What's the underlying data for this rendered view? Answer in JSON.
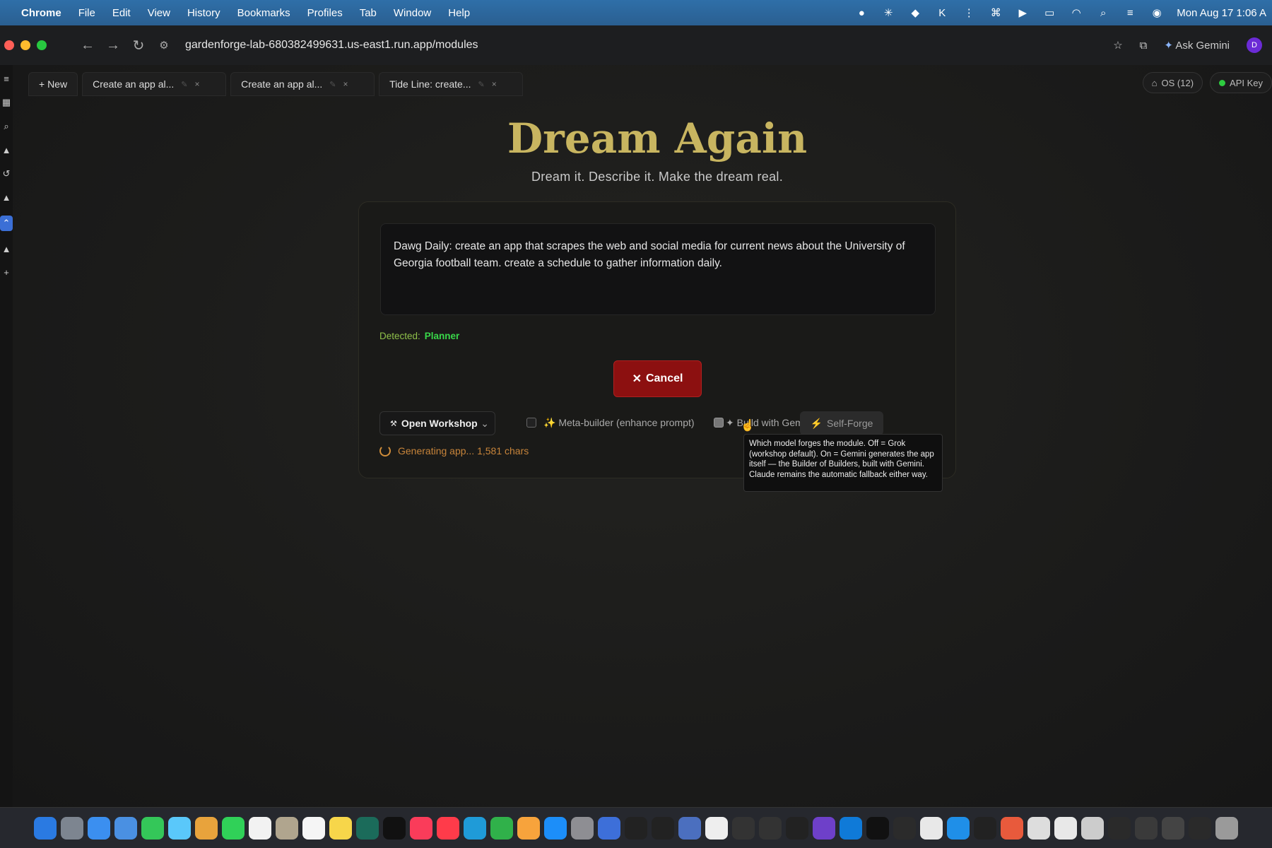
{
  "menubar": {
    "app": "Chrome",
    "items": [
      "File",
      "Edit",
      "View",
      "History",
      "Bookmarks",
      "Profiles",
      "Tab",
      "Window",
      "Help"
    ],
    "clock": "Mon Aug 17  1:06 A"
  },
  "browser": {
    "url": "gardenforge-lab-680382499631.us-east1.run.app/modules",
    "ask_gemini": "Ask Gemini",
    "profile_initial": "D"
  },
  "tabs": {
    "new_label": "+ New",
    "items": [
      {
        "label": "Create an app al..."
      },
      {
        "label": "Create an app al..."
      },
      {
        "label": "Tide Line: create..."
      }
    ]
  },
  "topright": {
    "os_label": "OS (12)",
    "api_label": "API Key"
  },
  "hero": {
    "title": "Dream Again",
    "subtitle": "Dream it. Describe it. Make the dream real."
  },
  "prompt": {
    "text": "Dawg Daily: create an app that scrapes the web and social media for current news about the University of Georgia football team. create a schedule to gather information daily."
  },
  "detected": {
    "label": "Detected:",
    "value": "Planner"
  },
  "cancel_label": "Cancel",
  "controls": {
    "workshop_label": "Open Workshop",
    "meta_builder_label": "Meta-builder (enhance prompt)",
    "build_gemini_label": "Build with Gemini",
    "self_forge_label": "Self-Forge"
  },
  "status": "Generating app... 1,581 chars",
  "tooltip": "Which model forges the module. Off = Grok (workshop default). On = Gemini generates the app itself — the Builder of Builders, built with Gemini. Claude remains the automatic fallback either way.",
  "colors": {
    "title_gold": "#c8b560",
    "cancel_red": "#8c1010",
    "detected_green": "#39d84a",
    "status_orange": "#c7843a"
  }
}
